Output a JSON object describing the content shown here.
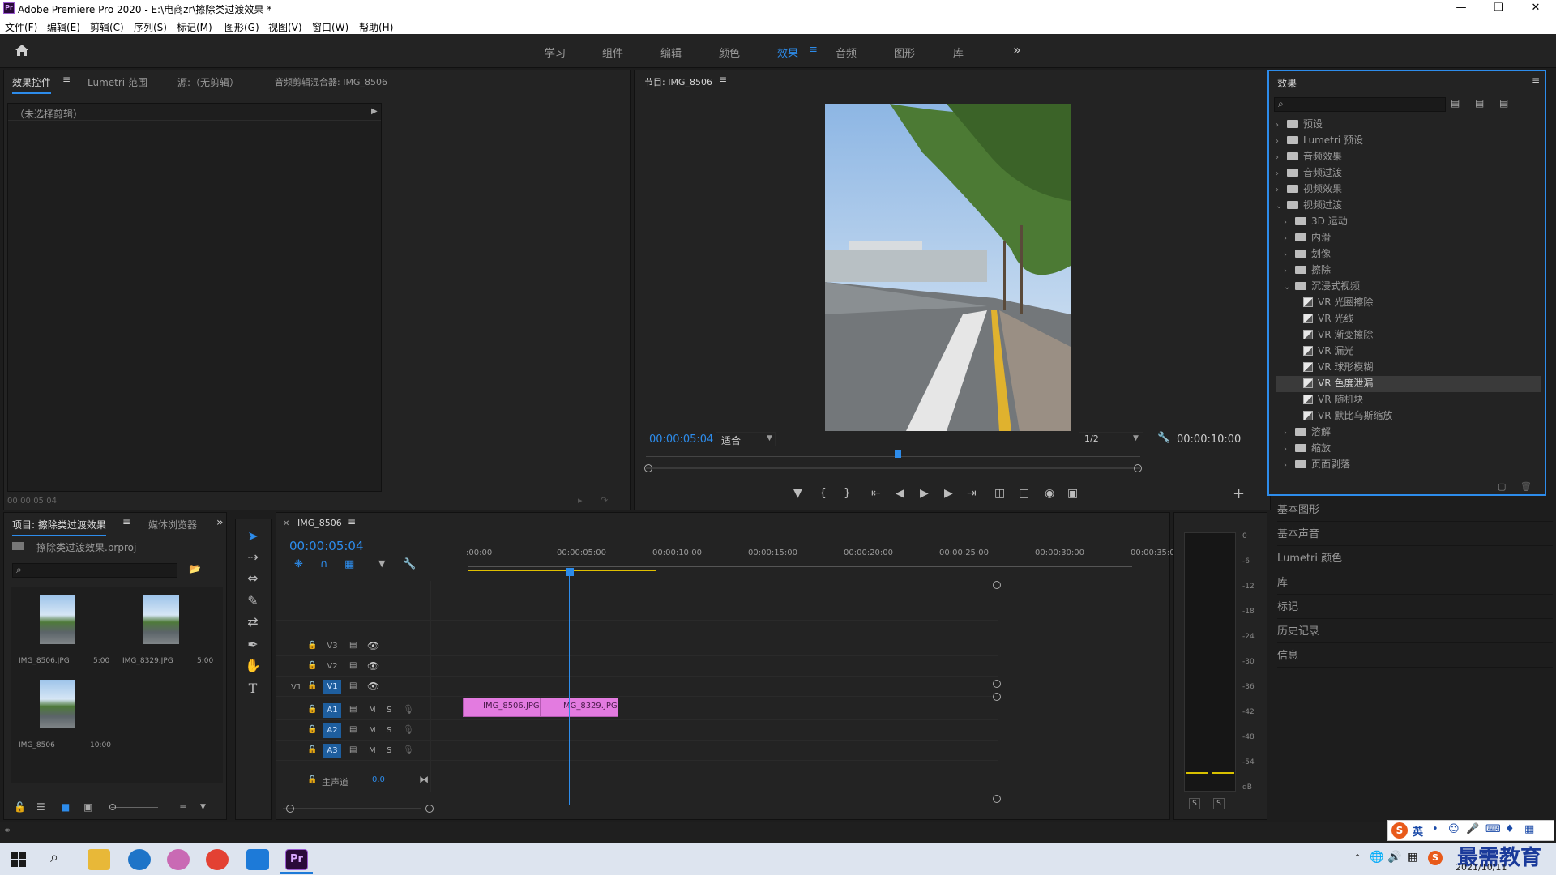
{
  "app": {
    "title": "Adobe Premiere Pro 2020 - E:\\电商zr\\擦除类过渡效果 *",
    "logo_text": "Pr",
    "window_controls": [
      "minimize-icon",
      "maximize-icon",
      "close-icon"
    ]
  },
  "menu": [
    "文件(F)",
    "编辑(E)",
    "剪辑(C)",
    "序列(S)",
    "标记(M)",
    "图形(G)",
    "视图(V)",
    "窗口(W)",
    "帮助(H)"
  ],
  "workspaces": {
    "tabs": [
      "学习",
      "组件",
      "编辑",
      "颜色",
      "效果",
      "音频",
      "图形",
      "库"
    ],
    "active": "效果",
    "more": "»"
  },
  "effect_controls": {
    "tabs": [
      "效果控件",
      "Lumetri 范围",
      "源:（无剪辑）",
      "音频剪辑混合器: IMG_8506"
    ],
    "active_tab": "效果控件",
    "no_clip": "（未选择剪辑）",
    "timecode": "00:00:05:04"
  },
  "program_monitor": {
    "title": "节目: IMG_8506",
    "timecode": "00:00:05:04",
    "fit": "适合",
    "resolution": "1/2",
    "duration": "00:00:10:00",
    "playhead_fraction": 0.51
  },
  "effects_panel": {
    "title": "效果",
    "search_placeholder": "",
    "tree": [
      {
        "label": "预设",
        "level": 0,
        "type": "folder",
        "expanded": false,
        "variant": "preset"
      },
      {
        "label": "Lumetri 预设",
        "level": 0,
        "type": "folder",
        "expanded": false,
        "variant": "preset"
      },
      {
        "label": "音频效果",
        "level": 0,
        "type": "folder",
        "expanded": false
      },
      {
        "label": "音频过渡",
        "level": 0,
        "type": "folder",
        "expanded": false
      },
      {
        "label": "视频效果",
        "level": 0,
        "type": "folder",
        "expanded": false
      },
      {
        "label": "视频过渡",
        "level": 0,
        "type": "folder",
        "expanded": true
      },
      {
        "label": "3D 运动",
        "level": 1,
        "type": "folder",
        "expanded": false
      },
      {
        "label": "内滑",
        "level": 1,
        "type": "folder",
        "expanded": false
      },
      {
        "label": "划像",
        "level": 1,
        "type": "folder",
        "expanded": false
      },
      {
        "label": "擦除",
        "level": 1,
        "type": "folder",
        "expanded": false
      },
      {
        "label": "沉浸式视频",
        "level": 1,
        "type": "folder",
        "expanded": true
      },
      {
        "label": "VR 光圈擦除",
        "level": 2,
        "type": "effect"
      },
      {
        "label": "VR 光线",
        "level": 2,
        "type": "effect"
      },
      {
        "label": "VR 渐变擦除",
        "level": 2,
        "type": "effect"
      },
      {
        "label": "VR 漏光",
        "level": 2,
        "type": "effect"
      },
      {
        "label": "VR 球形模糊",
        "level": 2,
        "type": "effect"
      },
      {
        "label": "VR 色度泄漏",
        "level": 2,
        "type": "effect",
        "selected": true
      },
      {
        "label": "VR 随机块",
        "level": 2,
        "type": "effect"
      },
      {
        "label": "VR 默比乌斯缩放",
        "level": 2,
        "type": "effect"
      },
      {
        "label": "溶解",
        "level": 1,
        "type": "folder",
        "expanded": false
      },
      {
        "label": "缩放",
        "level": 1,
        "type": "folder",
        "expanded": false
      },
      {
        "label": "页面剥落",
        "level": 1,
        "type": "folder",
        "expanded": false
      }
    ]
  },
  "side_panels": [
    "基本图形",
    "基本声音",
    "Lumetri 颜色",
    "库",
    "标记",
    "历史记录",
    "信息"
  ],
  "project": {
    "tabs": [
      "项目: 擦除类过渡效果",
      "媒体浏览器"
    ],
    "file": "擦除类过渡效果.prproj",
    "items": [
      {
        "name": "IMG_8506.JPG",
        "duration": "5:00"
      },
      {
        "name": "IMG_8329.JPG",
        "duration": "5:00"
      },
      {
        "name": "IMG_8506",
        "duration": "10:00"
      }
    ]
  },
  "timeline": {
    "sequence": "IMG_8506",
    "timecode": "00:00:05:04",
    "ruler": [
      ":00:00",
      "00:00:05:00",
      "00:00:10:00",
      "00:00:15:00",
      "00:00:20:00",
      "00:00:25:00",
      "00:00:30:00",
      "00:00:35:0"
    ],
    "video_tracks": [
      "V3",
      "V2",
      "V1"
    ],
    "audio_tracks": [
      "A1",
      "A2",
      "A3"
    ],
    "source_patch": "V1",
    "master": {
      "label": "主声道",
      "value": "0.0"
    },
    "clips": [
      "IMG_8506.JPG",
      "IMG_8329.JPG"
    ],
    "m_label": "M",
    "s_label": "S"
  },
  "audio_meter": {
    "scale": [
      "0",
      "-6",
      "-12",
      "-18",
      "-24",
      "-30",
      "-36",
      "-42",
      "-48",
      "-54",
      "dB"
    ],
    "solo": [
      "S",
      "S"
    ]
  },
  "taskbar": {
    "ime": [
      "英"
    ],
    "date": "2021/10/11",
    "watermark": "最需教育"
  }
}
